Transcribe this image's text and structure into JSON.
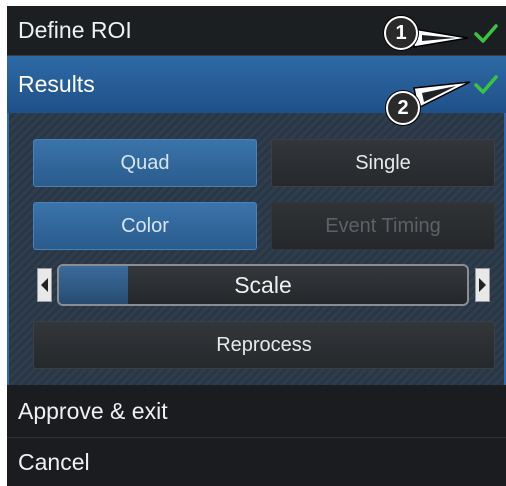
{
  "menu": {
    "define_roi": {
      "label": "Define ROI",
      "icon": "checkmark-icon",
      "check_color": "#3cc43c"
    },
    "results": {
      "label": "Results",
      "icon": "checkmark-icon",
      "check_color": "#3cc43c"
    },
    "approve_exit": {
      "label": "Approve & exit"
    },
    "cancel": {
      "label": "Cancel"
    }
  },
  "results_panel": {
    "buttons": {
      "quad": {
        "label": "Quad",
        "state": "active"
      },
      "single": {
        "label": "Single",
        "state": "normal"
      },
      "color": {
        "label": "Color",
        "state": "active"
      },
      "event_timing": {
        "label": "Event Timing",
        "state": "disabled"
      },
      "reprocess": {
        "label": "Reprocess",
        "state": "normal"
      }
    },
    "scale": {
      "label": "Scale",
      "level_fraction": 0.17,
      "left_icon": "arrow-left-icon",
      "right_icon": "arrow-right-icon"
    }
  },
  "callouts": [
    {
      "number": "1"
    },
    {
      "number": "2"
    }
  ],
  "colors": {
    "accent_blue": "#2e6aa6",
    "background": "#1e2124",
    "check_green": "#3cc43c"
  }
}
